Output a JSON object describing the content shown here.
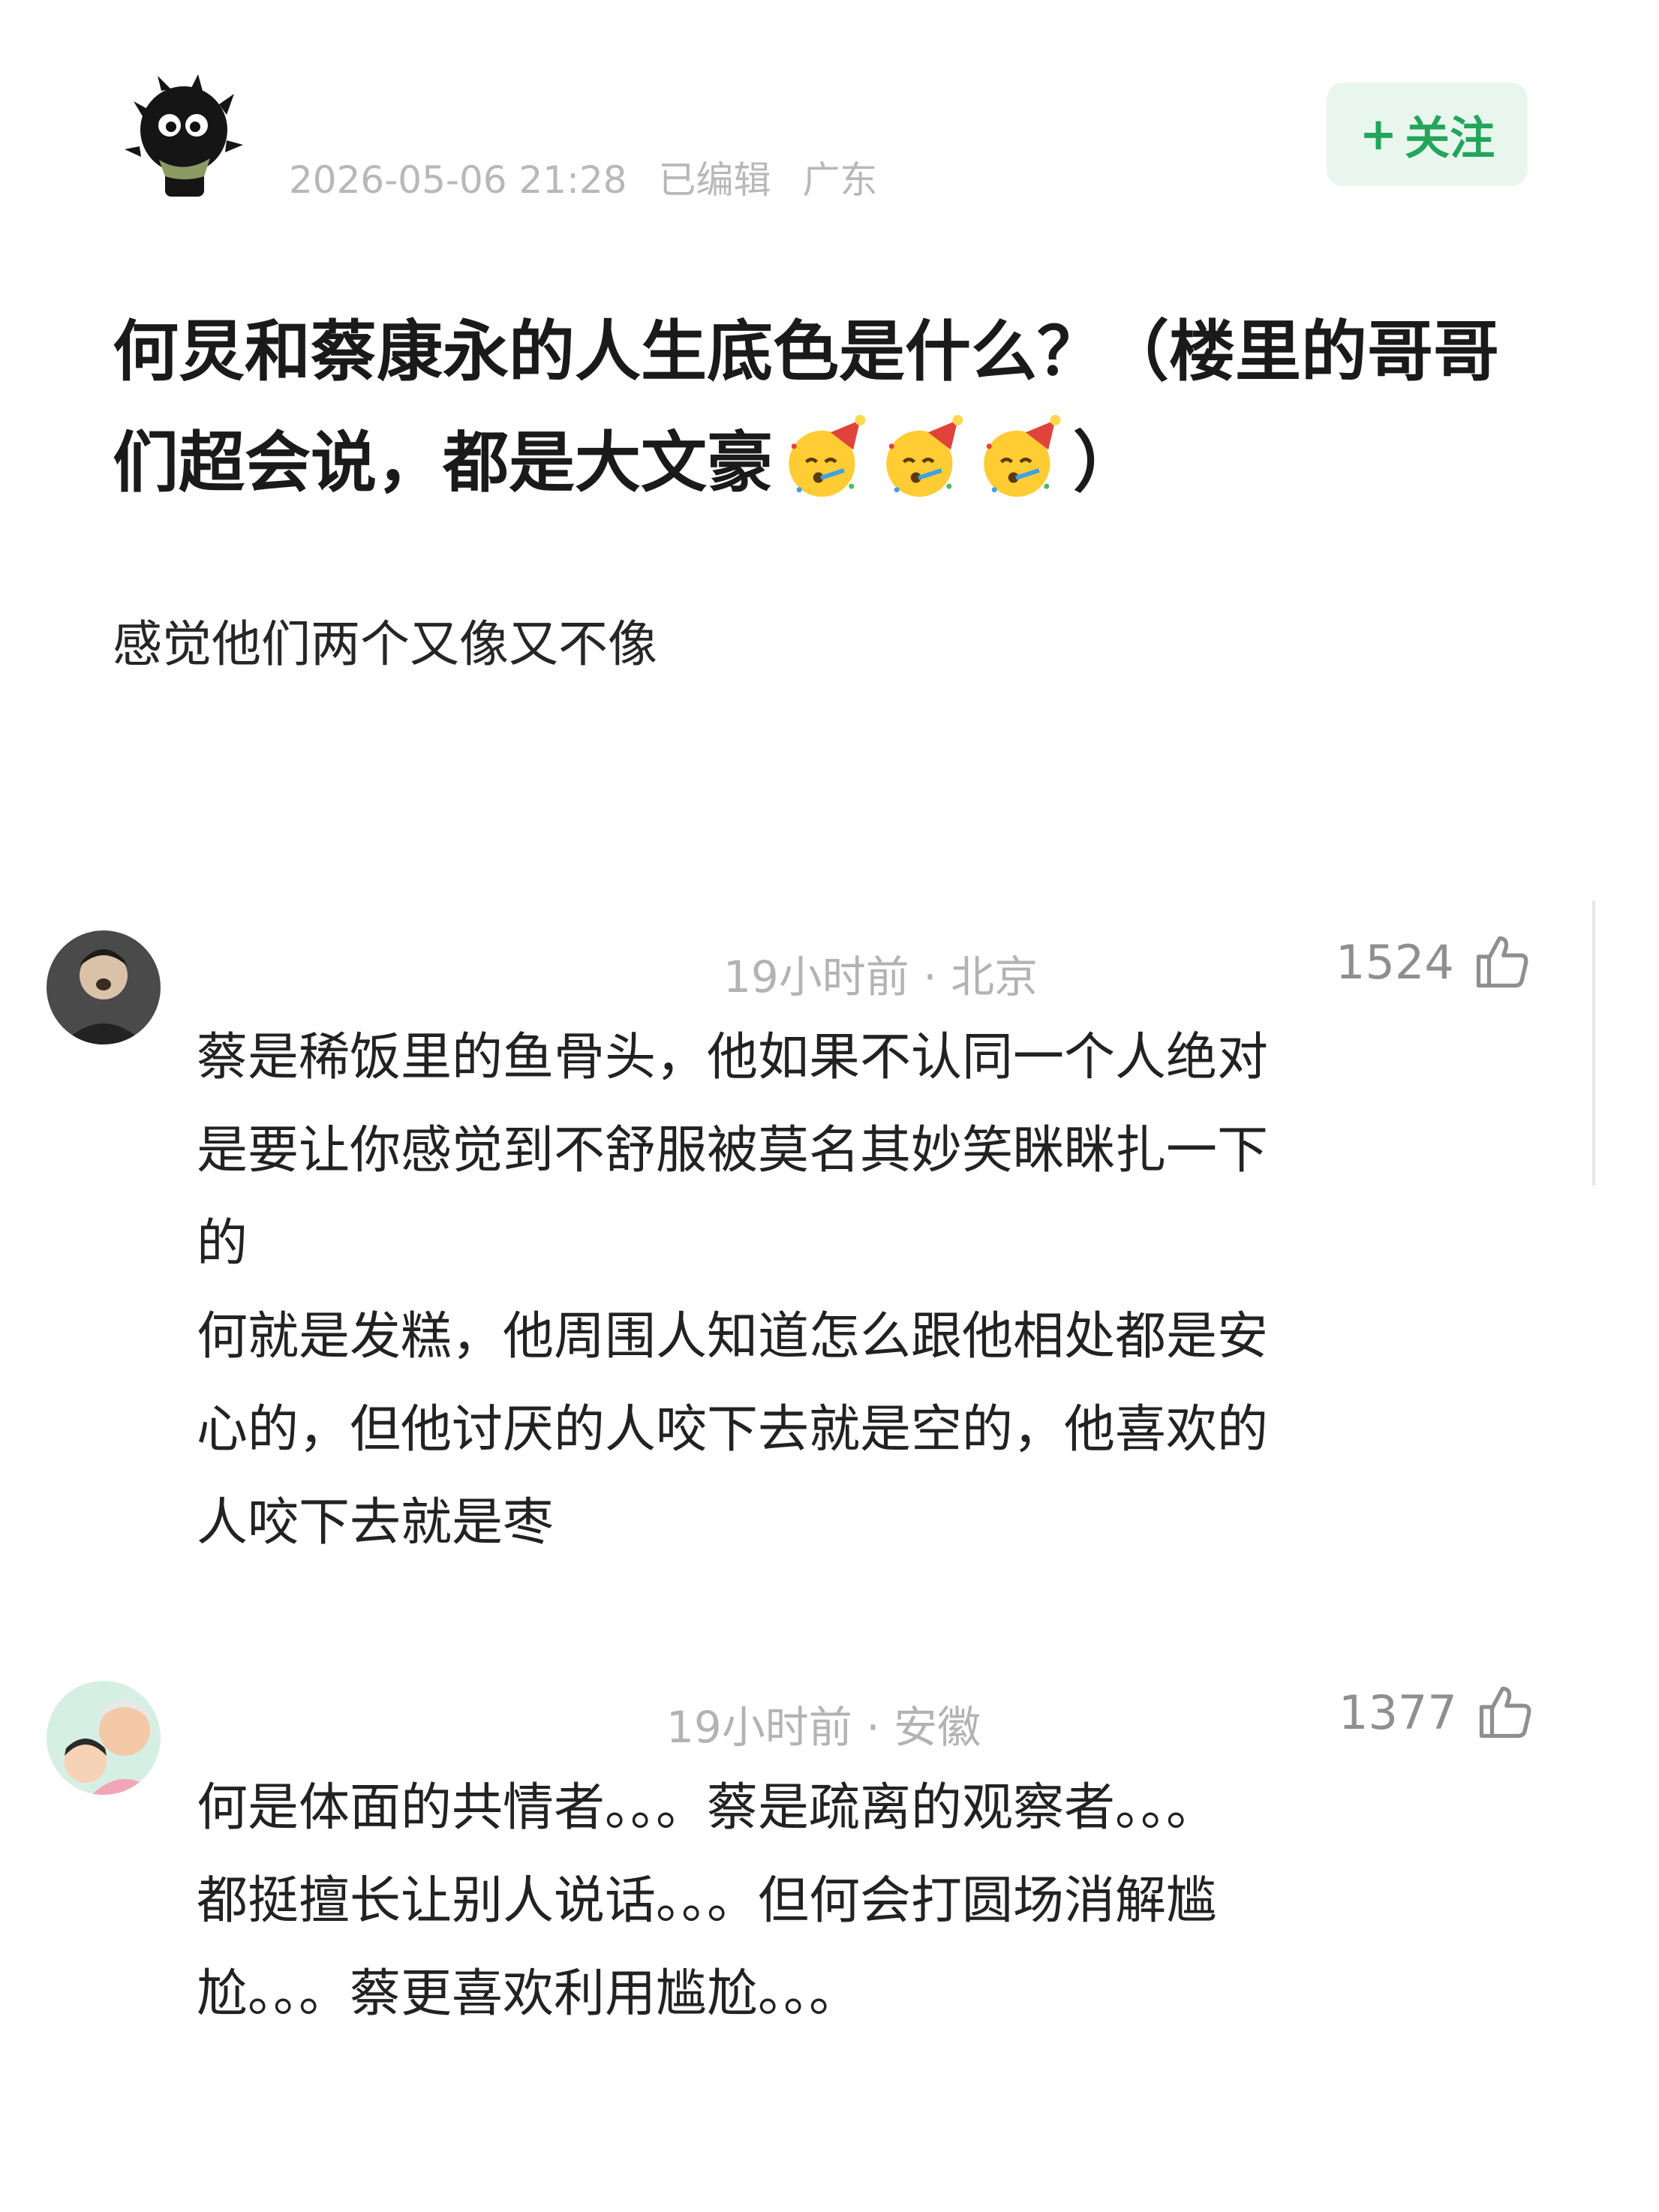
{
  "post": {
    "timestamp": "2026-05-06 21:28",
    "edited": "已编辑",
    "location": "广东",
    "follow": {
      "plus": "+",
      "label": "关注"
    },
    "title_text": "何炅和蔡康永的人生底色是什么？（楼里的哥哥们超会说，都是大文豪",
    "title_emoji": "partying-face-emoji",
    "title_emoji_count": 3,
    "title_close": "）",
    "body": "感觉他们两个又像又不像"
  },
  "comments": [
    {
      "time_location": "19小时前 · 北京",
      "likes": "1524",
      "text": "蔡是稀饭里的鱼骨头，他如果不认同一个人绝对\n是要让你感觉到不舒服被莫名其妙笑眯眯扎一下\n的\n何就是发糕，他周围人知道怎么跟他相处都是安\n心的，但他讨厌的人咬下去就是空的，他喜欢的\n人咬下去就是枣"
    },
    {
      "time_location": "19小时前 · 安徽",
      "likes": "1377",
      "text": "何是体面的共情者。。。蔡是疏离的观察者。。。\n都挺擅长让别人说话。。。但何会打圆场消解尴\n尬。。。蔡更喜欢利用尴尬。。。"
    }
  ],
  "icons": {
    "like": "thumbs-up-icon",
    "accent_green": "#23a55a"
  }
}
